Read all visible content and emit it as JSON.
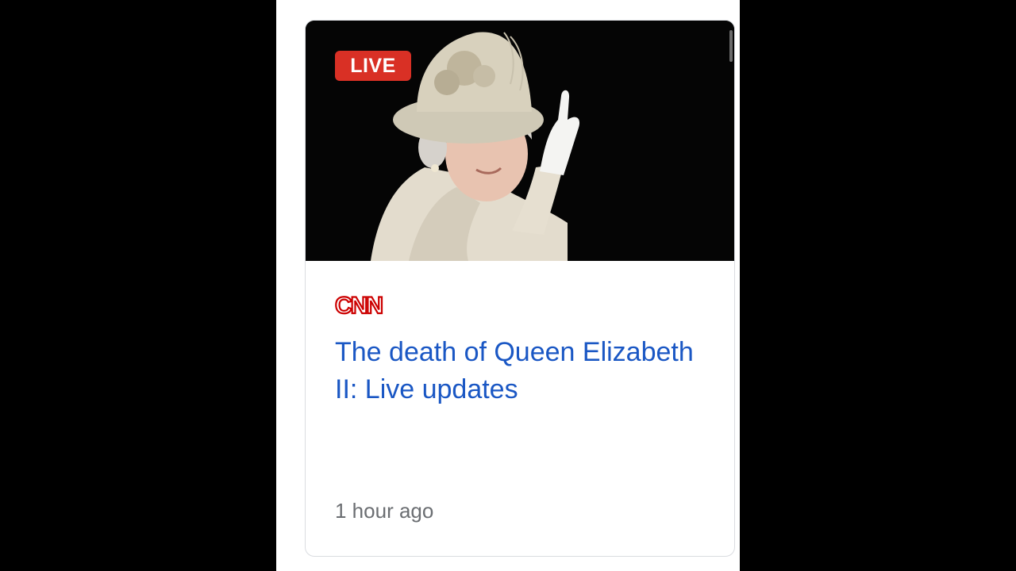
{
  "card": {
    "badge": "LIVE",
    "source": "CNN",
    "headline": "The death of Queen Elizabeth II: Live updates",
    "timestamp": "1 hour ago"
  },
  "colors": {
    "badge_bg": "#d93025",
    "headline": "#1a57c4",
    "cnn_red": "#cc0000",
    "timestamp": "#6b6e72"
  }
}
